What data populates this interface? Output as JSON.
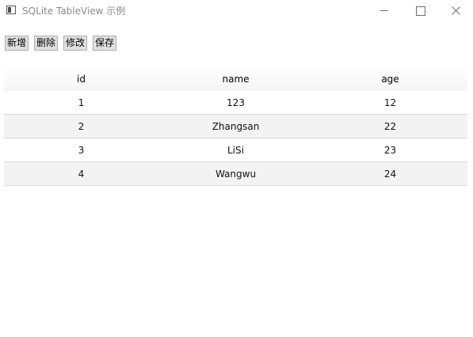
{
  "window": {
    "title": "SQLite TableView 示例",
    "icon": "window-app-icon"
  },
  "toolbar": {
    "add_label": "新增",
    "delete_label": "删除",
    "edit_label": "修改",
    "save_label": "保存"
  },
  "table": {
    "headers": [
      "id",
      "name",
      "age"
    ],
    "rows": [
      [
        "1",
        "123",
        "12"
      ],
      [
        "2",
        "Zhangsan",
        "22"
      ],
      [
        "3",
        "LiSi",
        "23"
      ],
      [
        "4",
        "Wangwu",
        "24"
      ]
    ]
  },
  "colors": {
    "row_alt": "#f3f3f3",
    "button_bg": "#e1e1e1",
    "title_text": "#8a8a8a"
  }
}
